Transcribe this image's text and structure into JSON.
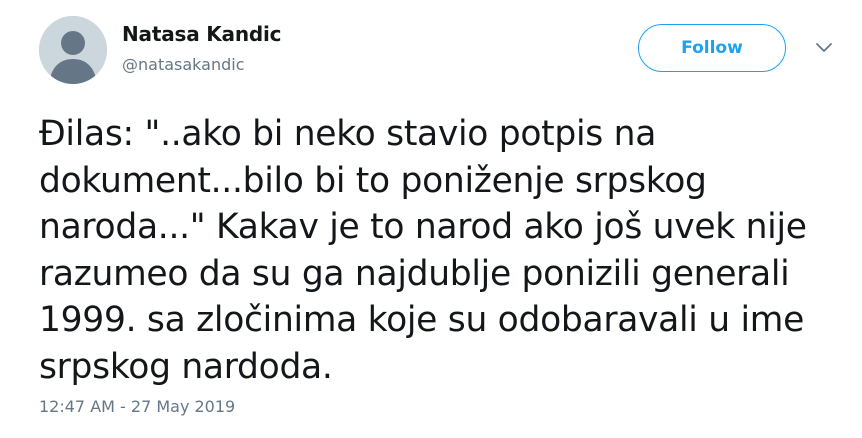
{
  "author": {
    "name": "Natasa Kandic",
    "handle": "@natasakandic"
  },
  "actions": {
    "follow_label": "Follow",
    "menu_icon": "chevron-down-icon"
  },
  "tweet": {
    "text": "Đilas: \"..ako bi neko stavio potpis na\ndokument...bilo bi to poniženje srpskog\nnaroda...\" Kakav je to narod ako još uvek nije\nrazumeo da su ga najdublje ponizili generali\n1999. sa zločinima koje su odobaravali u ime\nsrpskog nardoda.",
    "timestamp": "12:47 AM - 27 May 2019"
  },
  "colors": {
    "accent": "#1da1f2",
    "secondary_text": "#657786",
    "primary_text": "#14171a",
    "avatar_bg": "#ccd6dd",
    "avatar_figure": "#657786"
  }
}
